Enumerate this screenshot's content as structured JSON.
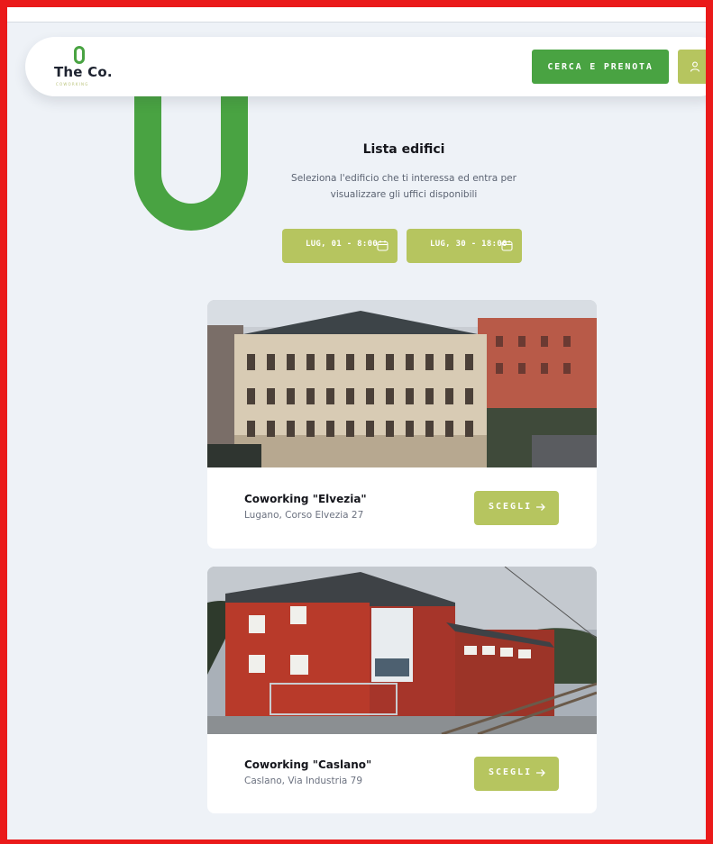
{
  "header": {
    "logo_text": "The Co.",
    "logo_subtext": "COWORKING",
    "cta_label": "CERCA E PRENOTA",
    "user_icon": "user-icon"
  },
  "main": {
    "title": "Lista edifici",
    "subtitle": "Seleziona l'edificio che ti interessa ed entra per visualizzare gli uffici disponibili",
    "date_from": "LUG, 01 - 8:00",
    "date_to": "LUG, 30 - 18:00",
    "calendar_icon": "calendar-icon"
  },
  "buildings": [
    {
      "name": "Coworking \"Elvezia\"",
      "address": "Lugano, Corso Elvezia 27",
      "button_label": "SCEGLI"
    },
    {
      "name": "Coworking \"Caslano\"",
      "address": "Caslano, Via Industria 79",
      "button_label": "SCEGLI"
    }
  ],
  "colors": {
    "brand_green": "#49a342",
    "olive": "#b6c55f",
    "background": "#eef2f7",
    "border_red": "#ea1a1a"
  }
}
